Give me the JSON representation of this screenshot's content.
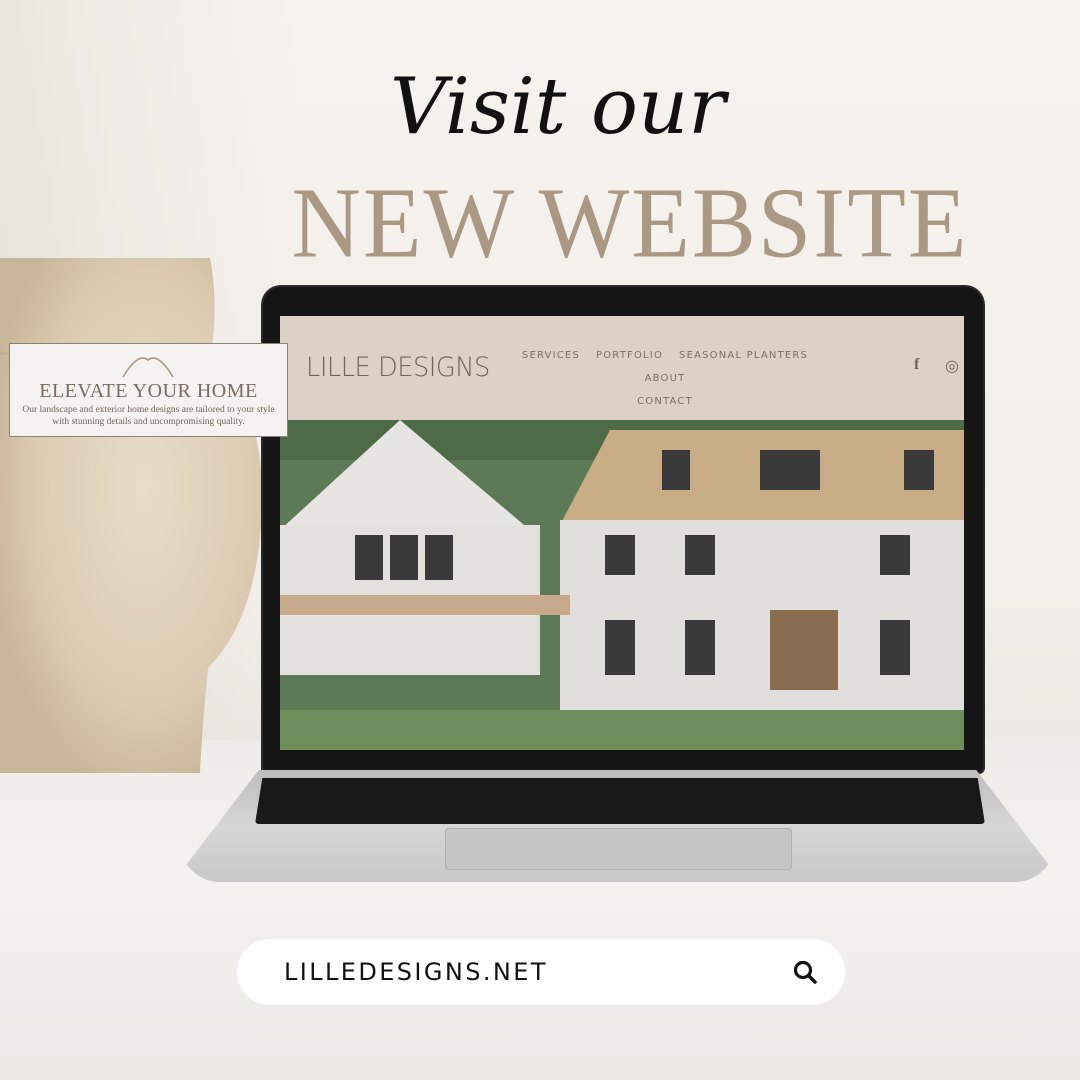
{
  "headline": {
    "script_line": "Visit our",
    "main_line": "NEW WEBSITE"
  },
  "colors": {
    "accent_taupe": "#ab9883",
    "nav_bg": "#ddd1c5",
    "text_dark": "#111111"
  },
  "website": {
    "logo": "LILLE DESIGNS",
    "nav": [
      "SERVICES",
      "PORTFOLIO",
      "SEASONAL PLANTERS",
      "ABOUT",
      "CONTACT"
    ],
    "social": {
      "facebook": "f",
      "instagram": "◎"
    },
    "hero_card": {
      "title": "ELEVATE YOUR HOME",
      "text": "Our landscape and exterior home designs are tailored to your style with stunning details and uncompromising quality."
    }
  },
  "search": {
    "value": "LILLEDESIGNS.NET",
    "icon": "search-icon"
  }
}
